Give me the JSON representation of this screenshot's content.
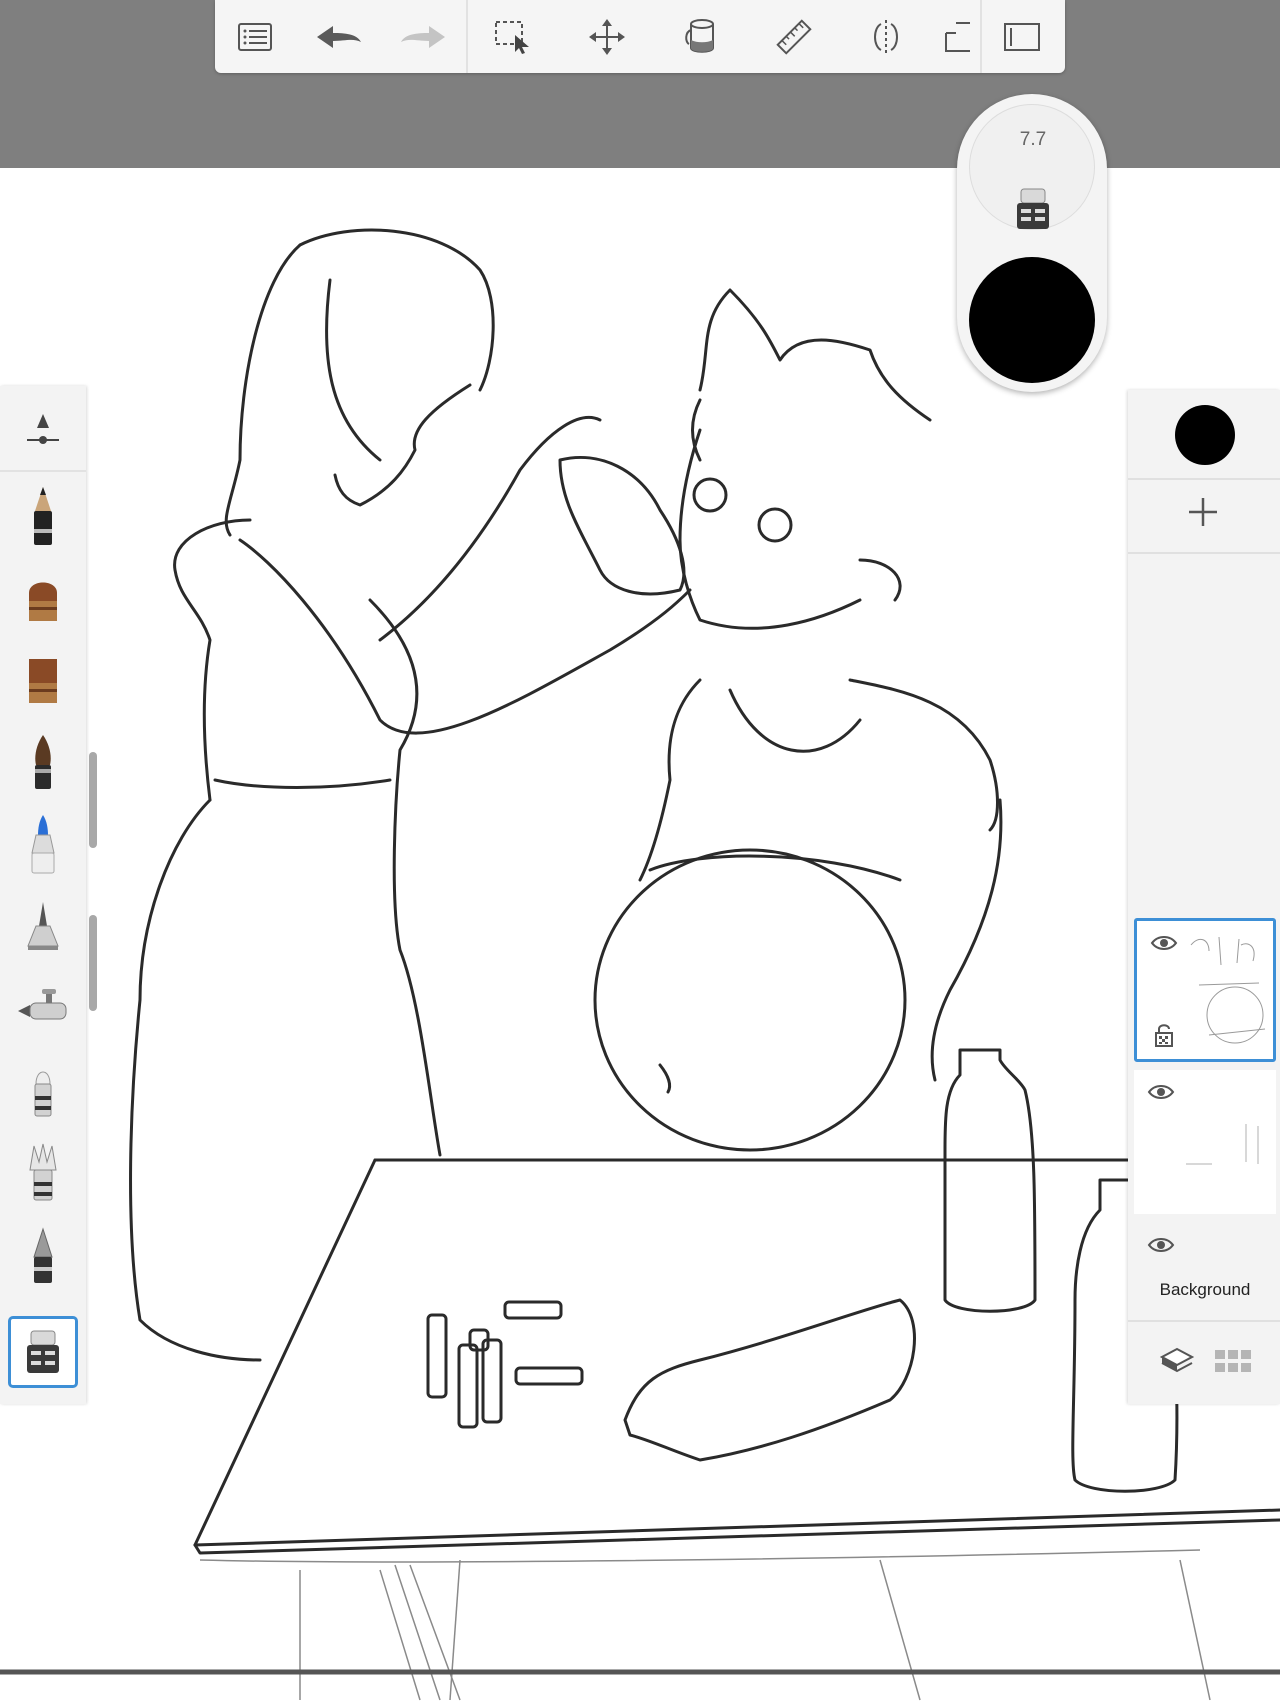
{
  "app": {
    "toolbar": {
      "items": [
        {
          "name": "menu",
          "icon": "list-menu-icon"
        },
        {
          "name": "undo",
          "icon": "undo-arrow-icon"
        },
        {
          "name": "redo",
          "icon": "redo-arrow-icon",
          "disabled": true
        },
        {
          "name": "selection",
          "icon": "selection-icon"
        },
        {
          "name": "transform",
          "icon": "move-arrows-icon"
        },
        {
          "name": "fill",
          "icon": "paint-bucket-icon"
        },
        {
          "name": "ruler",
          "icon": "ruler-icon"
        },
        {
          "name": "symmetry",
          "icon": "symmetry-icon"
        },
        {
          "name": "perspective",
          "icon": "perspective-icon"
        },
        {
          "name": "fullscreen",
          "icon": "fullscreen-icon"
        }
      ]
    },
    "brush_puck": {
      "size_value": "7.7",
      "active_brush_icon": "eraser-icon",
      "color": "#000000"
    },
    "brush_palette": {
      "items": [
        {
          "icon": "brush-properties-slider-icon"
        },
        {
          "icon": "pencil-brush-icon"
        },
        {
          "icon": "flat-paint-brush-icon"
        },
        {
          "icon": "square-paint-brush-icon"
        },
        {
          "icon": "round-paint-brush-icon"
        },
        {
          "icon": "marker-brush-icon"
        },
        {
          "icon": "ink-pen-brush-icon"
        },
        {
          "icon": "airbrush-icon"
        },
        {
          "icon": "smudge-brush-icon"
        },
        {
          "icon": "fan-brush-icon"
        },
        {
          "icon": "chisel-brush-icon"
        },
        {
          "icon": "eraser-icon",
          "selected": true
        }
      ]
    },
    "layers": {
      "current_color": "#000000",
      "add_layer_icon": "plus-icon",
      "items": [
        {
          "visible": true,
          "locked_icon": "lock-icon",
          "active": true,
          "label": ""
        },
        {
          "visible": true,
          "active": false,
          "label": ""
        },
        {
          "visible": true,
          "active": false,
          "label": "Background"
        }
      ],
      "bottom_buttons": [
        {
          "icon": "layers-stack-icon"
        },
        {
          "icon": "grid-view-icon"
        }
      ]
    },
    "colors": {
      "accent": "#3d8fd6",
      "header_band": "#7f7f7f",
      "panel": "#f3f3f3"
    }
  }
}
